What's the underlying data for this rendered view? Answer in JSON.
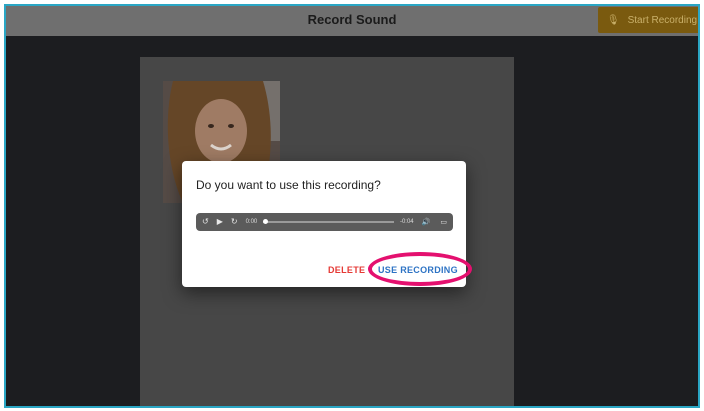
{
  "header": {
    "title": "Record Sound",
    "start_button_label": "Start Recording",
    "start_button_icon": "microphone-icon"
  },
  "dialog": {
    "question": "Do you want to use this recording?",
    "player": {
      "current_time": "0:00",
      "remaining_time": "-0:04",
      "progress": 0.0
    },
    "delete_label": "DELETE",
    "use_label": "USE RECORDING"
  },
  "colors": {
    "accent_use": "#2d73c4",
    "accent_delete": "#e53935",
    "highlight": "#e4106f",
    "start_button": "#7a5a0f"
  }
}
